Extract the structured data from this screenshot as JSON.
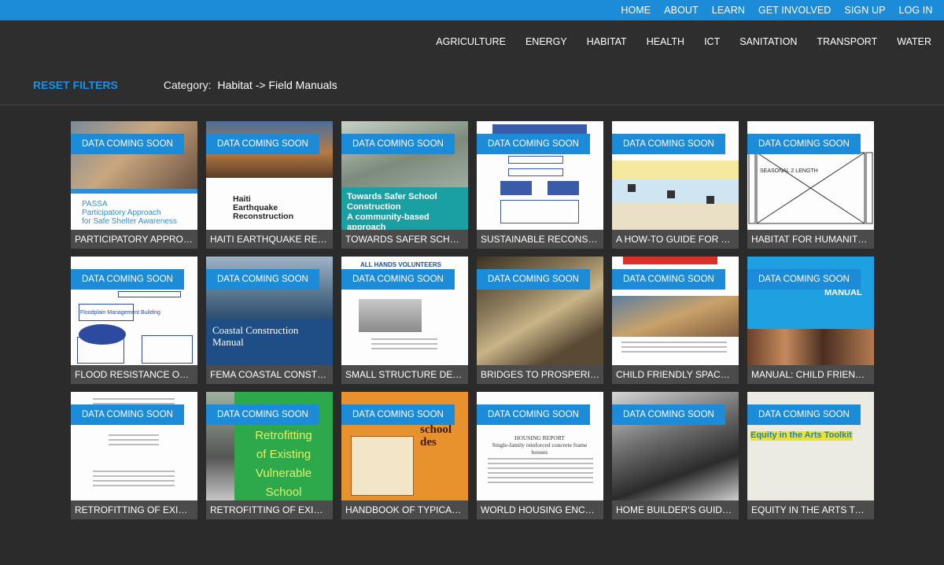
{
  "topnav": [
    "HOME",
    "ABOUT",
    "LEARN",
    "GET INVOLVED",
    "SIGN UP",
    "LOG IN"
  ],
  "categories": [
    "AGRICULTURE",
    "ENERGY",
    "HABITAT",
    "HEALTH",
    "ICT",
    "SANITATION",
    "TRANSPORT",
    "WATER"
  ],
  "filters": {
    "reset_label": "RESET FILTERS",
    "crumb_label": "Category:",
    "crumb_path": "Habitat -> Field Manuals"
  },
  "badge_text": "DATA COMING SOON",
  "cards": [
    {
      "title": "PARTICIPATORY APPROAC...",
      "thumb_text": "PASSA\nParticipatory Approach\nfor Safe Shelter Awareness"
    },
    {
      "title": "HAITI EARTHQUAKE RECO...",
      "thumb_text": "Haiti\nEarthquake\nReconstruction"
    },
    {
      "title": "TOWARDS SAFER SCHOOL ...",
      "thumb_text": "Towards Safer School\nConstruction\nA community-based approach"
    },
    {
      "title": "SUSTAINABLE RECONSTR...",
      "thumb_text": ""
    },
    {
      "title": "A HOW-TO GUIDE FOR THE ...",
      "thumb_text": ""
    },
    {
      "title": "HABITAT FOR HUMANITY: ...",
      "thumb_text": "SEASONAL 2 LENGTH"
    },
    {
      "title": "FLOOD RESISTANCE OF TH...",
      "thumb_text": "Floodplain Management\nBuilding"
    },
    {
      "title": "FEMA COASTAL CONSTRU...",
      "thumb_text": "Coastal Construction\nManual"
    },
    {
      "title": "SMALL STRUCTURE DEMO...",
      "thumb_text": "ALL HANDS VOLUNTEERS"
    },
    {
      "title": "BRIDGES TO PROSPERITY ...",
      "thumb_text": ""
    },
    {
      "title": "CHILD FRIENDLY SPACES I...",
      "thumb_text": ""
    },
    {
      "title": "MANUAL: CHILD FRIENDLY ...",
      "thumb_text": "MANUAL"
    },
    {
      "title": "RETROFITTING OF EXISTIN...",
      "thumb_text": ""
    },
    {
      "title": "RETROFITTING OF EXISTIN...",
      "thumb_text": "Retrofitting\nof Existing\nVulnerable\nSchool"
    },
    {
      "title": "HANDBOOK OF TYPICAL S...",
      "thumb_text": "school\ndes"
    },
    {
      "title": "WORLD HOUSING ENCYCL...",
      "thumb_text": "HOUSING REPORT\nSingle-family reinforced concrete frame houses"
    },
    {
      "title": "HOME BUILDER'S GUIDE T...",
      "thumb_text": ""
    },
    {
      "title": "EQUITY IN THE ARTS TOOL...",
      "thumb_text": "Equity in the Arts Toolkit"
    }
  ],
  "colors": {
    "accent": "#1c8bd8",
    "background": "#2b2b2b",
    "caption_bg": "#3c3c3c"
  }
}
